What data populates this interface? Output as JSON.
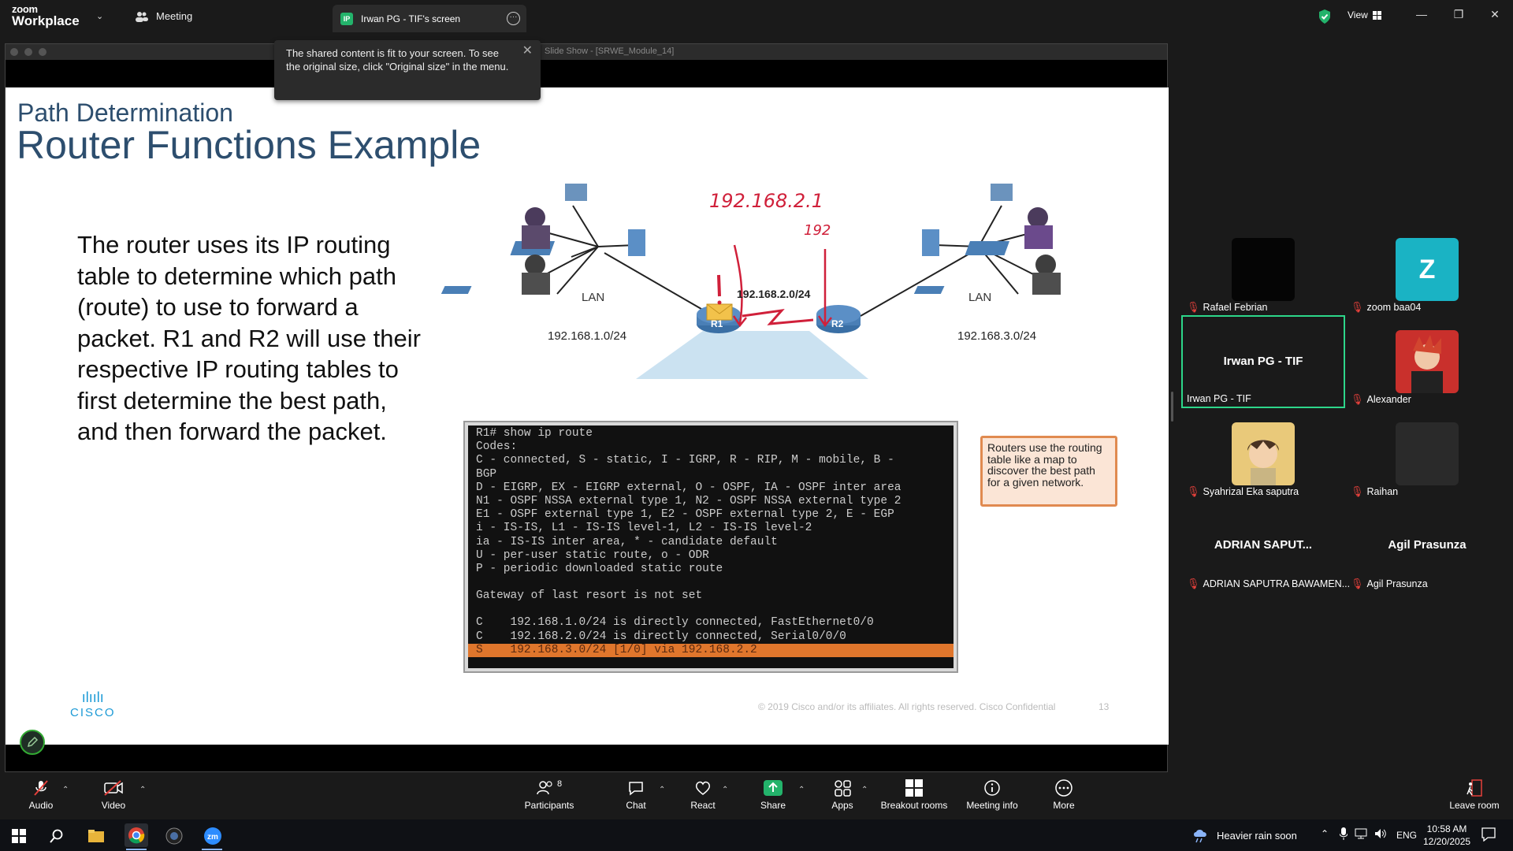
{
  "topbar": {
    "logo_line1": "zoom",
    "logo_line2": "Workplace",
    "meeting_label": "Meeting",
    "share_tab_badge": "IP",
    "share_tab_label": "Irwan PG - TIF's screen",
    "view_label": "View"
  },
  "shared_window": {
    "title": "Slide Show - [SRWE_Module_14]"
  },
  "toast": {
    "message": "The shared content is fit to your screen. To see the original size, click \"Original size\" in the menu."
  },
  "slide": {
    "section": "Path Determination",
    "title": "Router Functions Example",
    "body": "The router uses its IP routing table to determine which path (route) to use to forward a packet. R1 and R2 will use their respective IP routing tables to first determine the best path, and then forward the packet.",
    "diagram": {
      "left_lan": "LAN",
      "right_lan": "LAN",
      "left_network": "192.168.1.0/24",
      "middle_network": "192.168.2.0/24",
      "right_network": "192.168.3.0/24",
      "r1": "R1",
      "r2": "R2",
      "handwritten_1": "192.168.2.1",
      "handwritten_2": "192"
    },
    "terminal_lines": [
      "R1# show ip route",
      "Codes:",
      "C - connected, S - static, I - IGRP, R - RIP, M - mobile, B -",
      "BGP",
      "D - EIGRP, EX - EIGRP external, O - OSPF, IA - OSPF inter area",
      "N1 - OSPF NSSA external type 1, N2 - OSPF NSSA external type 2",
      "E1 - OSPF external type 1, E2 - OSPF external type 2, E - EGP",
      "i - IS-IS, L1 - IS-IS level-1, L2 - IS-IS level-2",
      "ia - IS-IS inter area, * - candidate default",
      "U - per-user static route, o - ODR",
      "P - periodic downloaded static route",
      "",
      "Gateway of last resort is not set",
      "",
      "C    192.168.1.0/24 is directly connected, FastEthernet0/0",
      "C    192.168.2.0/24 is directly connected, Serial0/0/0"
    ],
    "terminal_highlight": "S    192.168.3.0/24 [1/0] via 192.168.2.2",
    "callout": "Routers use the routing table like a map to discover the best path for a given network.",
    "logo": "CISCO",
    "footer": "© 2019  Cisco and/or its affiliates. All rights reserved.   Cisco Confidential",
    "page_number": "13"
  },
  "participants": {
    "rafael": "Rafael Febrian",
    "zoom_avatar_letter": "Z",
    "zoom": "zoom baa04",
    "irwan_big": "Irwan PG - TIF",
    "irwan": "Irwan PG - TIF",
    "alexander": "Alexander",
    "syahrizal": "Syahrizal Eka saputra",
    "raihan": "Raihan",
    "adrian_big": "ADRIAN SAPUT...",
    "adrian": "ADRIAN SAPUTRA BAWAMEN...",
    "agil_big": "Agil Prasunza",
    "agil": "Agil Prasunza"
  },
  "toolbar": {
    "audio": "Audio",
    "video": "Video",
    "participants": "Participants",
    "participants_count": "8",
    "chat": "Chat",
    "react": "React",
    "share": "Share",
    "apps": "Apps",
    "breakout": "Breakout rooms",
    "info": "Meeting info",
    "more": "More",
    "leave": "Leave room"
  },
  "taskbar": {
    "weather": "Heavier rain soon",
    "lang": "ENG",
    "time": "10:58 AM",
    "date": "12/20/2025"
  },
  "colors": {
    "active_border": "#2dd68a",
    "share_green": "#23b36b",
    "mic_off_red": "#e5403b",
    "slide_title": "#2d4e6e"
  }
}
